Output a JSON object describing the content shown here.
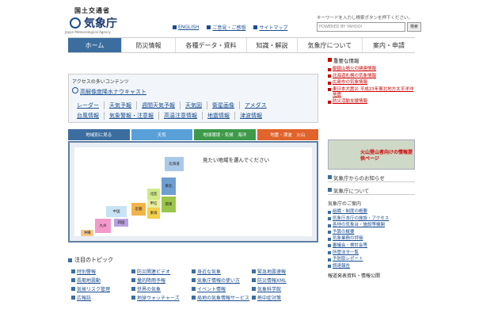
{
  "header": {
    "ministry": "国土交通省",
    "agency": "気象庁",
    "agency_en": "Japan Meteorological Agency",
    "links": [
      "ENGLISH",
      "ご意見・ご感想",
      "サイトマップ"
    ],
    "keyword_label": "キーワードを入力し検索ボタンを押下ください。",
    "search_placeholder": "POWERED BY YAHOO!",
    "search_button": "検索"
  },
  "nav": [
    {
      "label": "ホーム",
      "active": true
    },
    {
      "label": "防災情報",
      "active": false
    },
    {
      "label": "各種データ・資料",
      "active": false
    },
    {
      "label": "知識・解説",
      "active": false
    },
    {
      "label": "気象庁について",
      "active": false
    },
    {
      "label": "案内・申請",
      "active": false
    }
  ],
  "access": {
    "title": "アクセスの多いコンテンツ",
    "nowcast": "高解像度降水ナウキャスト",
    "row1": [
      "レーダー",
      "天気予報",
      "週間天気予報",
      "天気図",
      "衛星画像",
      "アメダス"
    ],
    "row2": [
      "台風情報",
      "気象警報・注意報",
      "高温注意情報",
      "地震情報",
      "津波情報"
    ]
  },
  "tabs": [
    {
      "label": "地域別に見る",
      "color": "#3b6e9f"
    },
    {
      "label": "天気",
      "color": "#5aa0d8"
    },
    {
      "label": "地球環境・気候　海洋",
      "color": "#3e9a4a"
    },
    {
      "label": "地震・津波　火山",
      "color": "#e0642c"
    }
  ],
  "map": {
    "prompt": "見たい地域を選んでください",
    "regions": [
      "北海道",
      "東北",
      "関東",
      "北陸",
      "甲信",
      "東海",
      "近畿",
      "中国",
      "四国",
      "九州",
      "沖縄"
    ]
  },
  "topics": {
    "title": "注目のトピック",
    "items": [
      "特別警報",
      "防災関連ビデオ",
      "身近な気象",
      "緊急地震速報",
      "長期地震動",
      "量的降雨予報",
      "気象庁情報の使い方",
      "防災情報XML",
      "気候リスク管理",
      "世界の気象",
      "イベント情報",
      "気象科学館",
      "広報誌",
      "地球ウォッチャーズ",
      "局地の気象情報サービス",
      "熱中症対策"
    ]
  },
  "right": {
    "important_title": "重要な情報",
    "important_items": [
      "御嶽山噴火の関連情報",
      "北海道札幌の気象情報",
      "広島市の気象情報",
      "東日本大震災 平成23年東北地方太平洋沖地震",
      "防災活動支援情報"
    ],
    "volcano_banner": "火山登山者向けの情報提供ページ",
    "notice_title": "気象庁からのお知らせ",
    "about_title": "気象庁について",
    "guide_title": "気象庁のご案内",
    "guide_items": [
      "組織・制度の概要",
      "気象庁本庁の施設・アクセス",
      "各地の気象台・施設等機関",
      "予算の概要",
      "気象業務の評価",
      "審議会・検討会等",
      "所管法令一覧",
      "予防取レポート",
      "調達報告"
    ],
    "last_heading": "報道発表資料・情報公開"
  },
  "colors": {
    "accent": "#3b6e9f",
    "link": "#1a4d8f",
    "alert": "#c00000"
  }
}
